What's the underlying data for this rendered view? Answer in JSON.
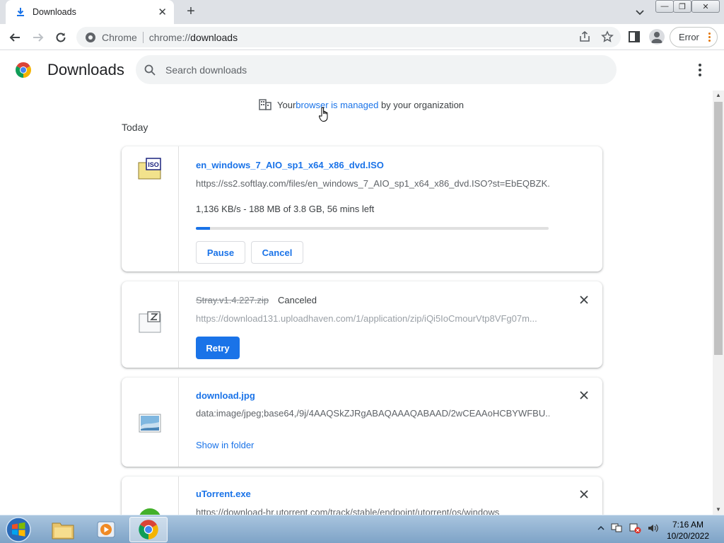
{
  "tab": {
    "title": "Downloads"
  },
  "window_controls": {
    "minimize": "—",
    "restore": "❐",
    "close": "✕"
  },
  "toolbar": {
    "site_label": "Chrome",
    "url_prefix": "chrome://",
    "url_path": "downloads",
    "error_label": "Error"
  },
  "page": {
    "title": "Downloads",
    "search_placeholder": "Search downloads"
  },
  "managed": {
    "prefix": "Your ",
    "link": "browser is managed",
    "suffix": " by your organization"
  },
  "section_date": "Today",
  "downloads": [
    {
      "name": "en_windows_7_AIO_sp1_x64_x86_dvd.ISO",
      "url": "https://ss2.softlay.com/files/en_windows_7_AIO_sp1_x64_x86_dvd.ISO?st=EbEQBZK...",
      "progress_text": "1,136 KB/s - 188 MB of 3.8 GB, 56 mins left",
      "progress_fraction": 0.04,
      "pause_label": "Pause",
      "cancel_label": "Cancel",
      "icon": "iso-file-icon"
    },
    {
      "name": "Stray.v1.4.227.zip",
      "status": "Canceled",
      "url": "https://download131.uploadhaven.com/1/application/zip/iQi5IoCmourVtp8VFg07m...",
      "retry_label": "Retry",
      "icon": "zip-file-icon"
    },
    {
      "name": "download.jpg",
      "url": "data:image/jpeg;base64,/9j/4AAQSkZJRgABAQAAAQABAAD/2wCEAAoHCBYWFBU...",
      "action_label": "Show in folder",
      "icon": "image-file-icon"
    },
    {
      "name": "uTorrent.exe",
      "url": "https://download-hr.utorrent.com/track/stable/endpoint/utorrent/os/windows",
      "icon": "utorrent-icon"
    }
  ],
  "taskbar": {
    "time": "7:16 AM",
    "date": "10/20/2022"
  },
  "colors": {
    "accent": "#1a73e8",
    "tabstrip": "#dee1e6",
    "taskbar": "#8fb0d2",
    "error_dots": "#e37400"
  }
}
